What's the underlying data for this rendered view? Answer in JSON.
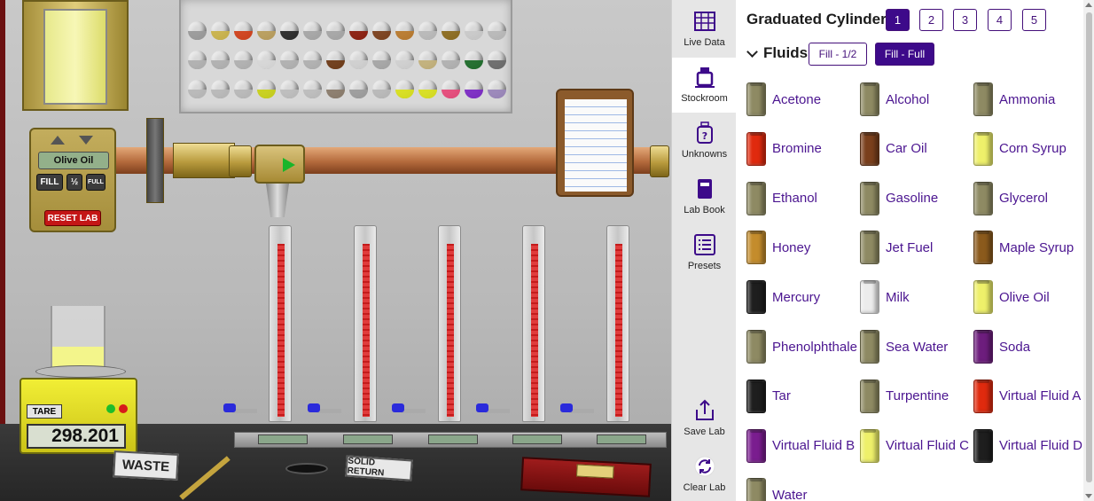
{
  "lab": {
    "pump": {
      "fluid_name": "Olive Oil",
      "fill_label": "FILL",
      "half_label": "½",
      "full_label": "FULL",
      "reset_label": "RESET LAB"
    },
    "balance": {
      "tare_label": "TARE",
      "reading": "298.201"
    },
    "signs": {
      "waste": "WASTE",
      "solid_return": "SOLID RETURN",
      "book_label": "Lab Book"
    },
    "shelf_colors": [
      [
        "#9a9a9a",
        "#c9b24a",
        "#d0401a",
        "#b89d5c",
        "#2a2a2a",
        "#a5a5a5",
        "#a5a5a5",
        "#8a1d0e",
        "#7a3f1c",
        "#b8792d",
        "#b8b8b8",
        "#8b6a1e",
        "#c9c9c9",
        "#b8b8b8"
      ],
      [
        "#b0b0b0",
        "#b0b0b0",
        "#b0b0b0",
        "#d7d7d7",
        "#b0b0b0",
        "#b0b0b0",
        "#6e3a16",
        "#d0d0d0",
        "#a5a5a5",
        "#d0d0d0",
        "#c2b07a",
        "#b0b0b0",
        "#1d6b2a",
        "#6a6a6a"
      ],
      [
        "#b8b8b8",
        "#b8b8b8",
        "#b8b8b8",
        "#c8d11a",
        "#bdbdbd",
        "#bdbdbd",
        "#8a7b6b",
        "#9c9c9c",
        "#b8b8b8",
        "#d8df1f",
        "#d8df1f",
        "#e64a7a",
        "#7b2ac4",
        "#9a86b9"
      ]
    ]
  },
  "toolbar": {
    "items": [
      {
        "id": "live-data",
        "label": "Live Data",
        "icon": "table-icon"
      },
      {
        "id": "stockroom",
        "label": "Stockroom",
        "icon": "flask-icon"
      },
      {
        "id": "unknowns",
        "label": "Unknowns",
        "icon": "unknown-bottle-icon"
      },
      {
        "id": "lab-book",
        "label": "Lab Book",
        "icon": "book-icon"
      },
      {
        "id": "presets",
        "label": "Presets",
        "icon": "list-icon"
      },
      {
        "id": "save-lab",
        "label": "Save Lab",
        "icon": "share-icon"
      },
      {
        "id": "clear-lab",
        "label": "Clear Lab",
        "icon": "refresh-icon"
      }
    ]
  },
  "panel": {
    "title": "Graduated Cylinder",
    "cylinder_buttons": [
      "1",
      "2",
      "3",
      "4",
      "5"
    ],
    "selected_cylinder": "1",
    "fluids_heading": "Fluids",
    "fill_half_label": "Fill - 1/2",
    "fill_full_label": "Fill - Full",
    "fluids": [
      {
        "name": "Acetone",
        "color": "#8e8a63"
      },
      {
        "name": "Alcohol",
        "color": "#8e8a63"
      },
      {
        "name": "Ammonia",
        "color": "#8e8a63"
      },
      {
        "name": "Bromine",
        "color": "#e02a0e"
      },
      {
        "name": "Car Oil",
        "color": "#7a3f1c"
      },
      {
        "name": "Corn Syrup",
        "color": "#eef06a"
      },
      {
        "name": "Ethanol",
        "color": "#8e8a63"
      },
      {
        "name": "Gasoline",
        "color": "#8e8a63"
      },
      {
        "name": "Glycerol",
        "color": "#8e8a63"
      },
      {
        "name": "Honey",
        "color": "#c48c2c"
      },
      {
        "name": "Jet Fuel",
        "color": "#8e8a63"
      },
      {
        "name": "Maple Syrup",
        "color": "#8b5a1c"
      },
      {
        "name": "Mercury",
        "color": "#1e1e1e"
      },
      {
        "name": "Milk",
        "color": "#ececec"
      },
      {
        "name": "Olive Oil",
        "color": "#eef06a"
      },
      {
        "name": "Phenolphthale",
        "color": "#8e8a63"
      },
      {
        "name": "Sea Water",
        "color": "#8e8a63"
      },
      {
        "name": "Soda",
        "color": "#6d1d7d"
      },
      {
        "name": "Tar",
        "color": "#1e1e1e"
      },
      {
        "name": "Turpentine",
        "color": "#8e8a63"
      },
      {
        "name": "Virtual Fluid A",
        "color": "#e02a0e"
      },
      {
        "name": "Virtual Fluid B",
        "color": "#7a1d8f"
      },
      {
        "name": "Virtual Fluid C",
        "color": "#eef06a"
      },
      {
        "name": "Virtual Fluid D",
        "color": "#1e1e1e"
      },
      {
        "name": "Water",
        "color": "#8e8a63"
      }
    ]
  }
}
